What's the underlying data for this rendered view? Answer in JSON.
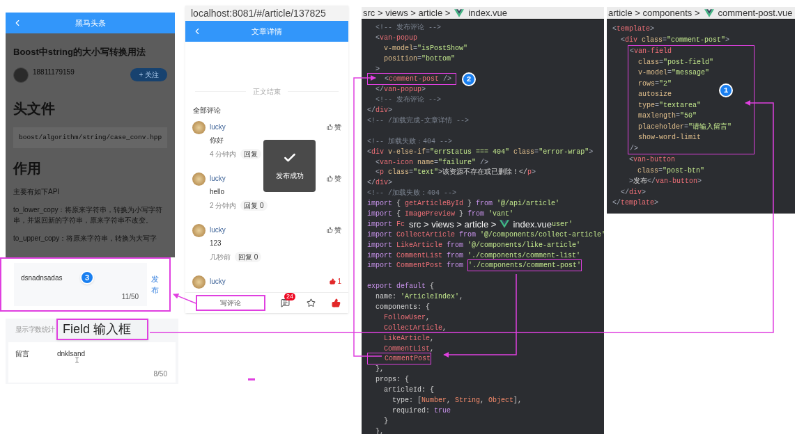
{
  "article_phone": {
    "header": {
      "title": "黑马头条"
    },
    "title": "Boost中string的大小写转换用法",
    "author": {
      "name": "18811179159"
    },
    "follow_button": "+ 关注",
    "heading_1": "头文件",
    "code": "boost/algorithm/string/case_conv.hpp",
    "heading_2": "作用",
    "paragraphs": [
      "主要有如下API",
      "to_lower_copy：将原来字符串，转换为小写字符串，并返回新的字符串，原来字符串不改变。",
      "to_upper_copy：将原来字符串，转换为大写字"
    ],
    "popup": {
      "value": "dsnadnsadas",
      "counter": "11/50",
      "post_button": "发布",
      "badge": "3"
    }
  },
  "field_demo": {
    "section_label": "显示字数统计",
    "label": "留言",
    "value": "dnklsand",
    "counter": "8/50"
  },
  "callout": "Field 输入框",
  "detail_phone": {
    "url": "localhost:8081/#/article/137825",
    "header": {
      "title": "文章详情"
    },
    "end_label": "正文结束",
    "comments_title": "全部评论",
    "comments": [
      {
        "name": "lucky",
        "content": "你好",
        "time": "4 分钟内",
        "reply": "回复",
        "like": "赞",
        "liked": false
      },
      {
        "name": "lucky",
        "content": "hello",
        "time": "2 分钟内",
        "reply": "回复 0",
        "like": "赞",
        "liked": false
      },
      {
        "name": "lucky",
        "content": "123",
        "time": "几秒前",
        "reply": "回复 0",
        "like": "赞",
        "liked": false
      },
      {
        "name": "lucky",
        "like": "1",
        "liked": true
      }
    ],
    "toast": "发布成功",
    "bottom_bar": {
      "write_button": "写评论",
      "comment_count": "24",
      "collected": false,
      "liked": true
    }
  },
  "index_editor": {
    "breadcrumb": {
      "path": "src > views > article >",
      "file": "index.vue"
    },
    "lines": [
      {
        "kind": "code",
        "segments": [
          {
            "kind": "comment",
            "text": "  <!-- 发布评论 -->"
          }
        ]
      },
      {
        "kind": "code",
        "segments": [
          {
            "kind": "punct",
            "text": "  <"
          },
          {
            "kind": "tag",
            "text": "van-popup"
          }
        ]
      },
      {
        "kind": "code",
        "segments": [
          {
            "kind": "attr",
            "text": "    v-model"
          },
          {
            "kind": "punct",
            "text": "="
          },
          {
            "kind": "string",
            "text": "\"isPostShow\""
          }
        ]
      },
      {
        "kind": "code",
        "segments": [
          {
            "kind": "attr",
            "text": "    position"
          },
          {
            "kind": "punct",
            "text": "="
          },
          {
            "kind": "string",
            "text": "\"bottom\""
          }
        ]
      },
      {
        "kind": "code",
        "segments": [
          {
            "kind": "punct",
            "text": "  >"
          }
        ]
      },
      {
        "kind": "code",
        "badge": "2",
        "segments": [
          {
            "kind": "punct",
            "text": "    <",
            "boxed": true
          },
          {
            "kind": "tag",
            "text": "comment-post",
            "boxed": true
          },
          {
            "kind": "punct",
            "text": " /> ",
            "boxed": true
          }
        ]
      },
      {
        "kind": "code",
        "segments": [
          {
            "kind": "punct",
            "text": "  </"
          },
          {
            "kind": "tag",
            "text": "van-popup"
          },
          {
            "kind": "punct",
            "text": ">"
          }
        ]
      },
      {
        "kind": "code",
        "segments": [
          {
            "kind": "comment",
            "text": "  <!-- 发布评论 -->"
          }
        ]
      },
      {
        "kind": "code",
        "segments": [
          {
            "kind": "punct",
            "text": "</"
          },
          {
            "kind": "tag",
            "text": "div"
          },
          {
            "kind": "punct",
            "text": ">"
          }
        ]
      },
      {
        "kind": "code",
        "segments": [
          {
            "kind": "comment",
            "text": "<!-- /加载完成-文章详情 -->"
          }
        ]
      },
      {
        "kind": "blank"
      },
      {
        "kind": "code",
        "segments": [
          {
            "kind": "comment",
            "text": "<!-- 加载失败：404 -->"
          }
        ]
      },
      {
        "kind": "code",
        "segments": [
          {
            "kind": "punct",
            "text": "<"
          },
          {
            "kind": "tag",
            "text": "div"
          },
          {
            "kind": "attr",
            "text": " v-else-if"
          },
          {
            "kind": "punct",
            "text": "="
          },
          {
            "kind": "string",
            "text": "\"errStatus === 404\""
          },
          {
            "kind": "attr",
            "text": " class"
          },
          {
            "kind": "punct",
            "text": "="
          },
          {
            "kind": "string",
            "text": "\"error-wrap\""
          },
          {
            "kind": "punct",
            "text": ">"
          }
        ]
      },
      {
        "kind": "code",
        "segments": [
          {
            "kind": "punct",
            "text": "  <"
          },
          {
            "kind": "tag",
            "text": "van-icon"
          },
          {
            "kind": "attr",
            "text": " name"
          },
          {
            "kind": "punct",
            "text": "="
          },
          {
            "kind": "string",
            "text": "\"failure\""
          },
          {
            "kind": "punct",
            "text": " />"
          }
        ]
      },
      {
        "kind": "code",
        "segments": [
          {
            "kind": "punct",
            "text": "  <"
          },
          {
            "kind": "tag",
            "text": "p"
          },
          {
            "kind": "attr",
            "text": " class"
          },
          {
            "kind": "punct",
            "text": "="
          },
          {
            "kind": "string",
            "text": "\"text\""
          },
          {
            "kind": "plain",
            "text": ">该资源不存在或已删除！</"
          },
          {
            "kind": "tag",
            "text": "p"
          },
          {
            "kind": "punct",
            "text": ">"
          }
        ]
      },
      {
        "kind": "code",
        "segments": [
          {
            "kind": "punct",
            "text": "</"
          },
          {
            "kind": "tag",
            "text": "div"
          },
          {
            "kind": "punct",
            "text": ">"
          }
        ]
      },
      {
        "kind": "code",
        "segments": [
          {
            "kind": "comment",
            "text": "<!-- /加载失败：404 -->"
          }
        ]
      },
      {
        "kind": "code",
        "segments": [
          {
            "kind": "keyword",
            "text": "import"
          },
          {
            "kind": "plain",
            "text": " { "
          },
          {
            "kind": "ident",
            "text": "getArticleById"
          },
          {
            "kind": "plain",
            "text": " } "
          },
          {
            "kind": "keyword",
            "text": "from"
          },
          {
            "kind": "string",
            "text": " '@/api/article'"
          }
        ]
      },
      {
        "kind": "code",
        "segments": [
          {
            "kind": "keyword",
            "text": "import"
          },
          {
            "kind": "plain",
            "text": " { "
          },
          {
            "kind": "ident",
            "text": "ImagePreview"
          },
          {
            "kind": "plain",
            "text": " } "
          },
          {
            "kind": "keyword",
            "text": "from"
          },
          {
            "kind": "string",
            "text": " 'vant'"
          }
        ]
      },
      {
        "kind": "code",
        "segments": [
          {
            "kind": "keyword",
            "text": "import"
          },
          {
            "kind": "ident",
            "text": " Fc "
          },
          {
            "kind": "crumb",
            "text": "src > views > article >"
          },
          {
            "kind": "vue_logo"
          },
          {
            "kind": "crumb",
            "text": "index.vue"
          },
          {
            "kind": "string",
            "text": "user'"
          }
        ]
      },
      {
        "kind": "code",
        "segments": [
          {
            "kind": "keyword",
            "text": "import"
          },
          {
            "kind": "ident",
            "text": " CollectArticle "
          },
          {
            "kind": "keyword",
            "text": "from"
          },
          {
            "kind": "string",
            "text": " '@/components/collect-article'"
          }
        ]
      },
      {
        "kind": "code",
        "segments": [
          {
            "kind": "keyword",
            "text": "import"
          },
          {
            "kind": "ident",
            "text": " LikeArticle "
          },
          {
            "kind": "keyword",
            "text": "from"
          },
          {
            "kind": "string",
            "text": " '@/components/like-article'"
          }
        ]
      },
      {
        "kind": "code",
        "segments": [
          {
            "kind": "keyword",
            "text": "import"
          },
          {
            "kind": "ident",
            "text": " CommentList "
          },
          {
            "kind": "keyword",
            "text": "from"
          },
          {
            "kind": "string",
            "text": " './components/comment-list'"
          }
        ]
      },
      {
        "kind": "code",
        "segments": [
          {
            "kind": "keyword",
            "text": "import"
          },
          {
            "kind": "ident",
            "text": " CommentPost "
          },
          {
            "kind": "keyword",
            "text": "from "
          },
          {
            "kind": "string",
            "text": "'./components/comment-post'",
            "boxed": true
          }
        ]
      },
      {
        "kind": "blank"
      },
      {
        "kind": "code",
        "segments": [
          {
            "kind": "keyword",
            "text": "export default"
          },
          {
            "kind": "plain",
            "text": " {"
          }
        ]
      },
      {
        "kind": "code",
        "segments": [
          {
            "kind": "plain",
            "text": "  name: "
          },
          {
            "kind": "string",
            "text": "'ArticleIndex'"
          },
          {
            "kind": "plain",
            "text": ","
          }
        ]
      },
      {
        "kind": "code",
        "segments": [
          {
            "kind": "plain",
            "text": "  components: {"
          }
        ]
      },
      {
        "kind": "code",
        "segments": [
          {
            "kind": "ident",
            "text": "    FollowUser"
          },
          {
            "kind": "plain",
            "text": ","
          }
        ]
      },
      {
        "kind": "code",
        "segments": [
          {
            "kind": "ident",
            "text": "    CollectArticle"
          },
          {
            "kind": "plain",
            "text": ","
          }
        ]
      },
      {
        "kind": "code",
        "segments": [
          {
            "kind": "ident",
            "text": "    LikeArticle"
          },
          {
            "kind": "plain",
            "text": ","
          }
        ]
      },
      {
        "kind": "code",
        "segments": [
          {
            "kind": "ident",
            "text": "    CommentList"
          },
          {
            "kind": "plain",
            "text": ","
          }
        ]
      },
      {
        "kind": "code",
        "segments": [
          {
            "kind": "ident",
            "text": "    CommentPost",
            "boxed": true
          }
        ]
      },
      {
        "kind": "code",
        "segments": [
          {
            "kind": "plain",
            "text": "  },"
          }
        ]
      },
      {
        "kind": "code",
        "segments": [
          {
            "kind": "plain",
            "text": "  props: {"
          }
        ]
      },
      {
        "kind": "code",
        "segments": [
          {
            "kind": "plain",
            "text": "    articleId: {"
          }
        ]
      },
      {
        "kind": "code",
        "segments": [
          {
            "kind": "plain",
            "text": "      type: ["
          },
          {
            "kind": "number",
            "text": "Number"
          },
          {
            "kind": "plain",
            "text": ", "
          },
          {
            "kind": "number",
            "text": "String"
          },
          {
            "kind": "plain",
            "text": ", "
          },
          {
            "kind": "number",
            "text": "Object"
          },
          {
            "kind": "plain",
            "text": "],"
          }
        ]
      },
      {
        "kind": "code",
        "segments": [
          {
            "kind": "plain",
            "text": "      required: "
          },
          {
            "kind": "keyword",
            "text": "true"
          }
        ]
      },
      {
        "kind": "code",
        "segments": [
          {
            "kind": "plain",
            "text": "    }"
          }
        ]
      },
      {
        "kind": "code",
        "segments": [
          {
            "kind": "plain",
            "text": "  },"
          }
        ]
      }
    ]
  },
  "post_editor": {
    "breadcrumb": {
      "path": "article > components >",
      "file": "comment-post.vue"
    },
    "lines_before": [
      {
        "kind": "code",
        "segments": [
          {
            "kind": "punct",
            "text": "<"
          },
          {
            "kind": "tag",
            "text": "template"
          },
          {
            "kind": "punct",
            "text": ">"
          }
        ]
      },
      {
        "kind": "code",
        "segments": [
          {
            "kind": "punct",
            "text": "  <"
          },
          {
            "kind": "tag",
            "text": "div"
          },
          {
            "kind": "attr",
            "text": " class"
          },
          {
            "kind": "punct",
            "text": "="
          },
          {
            "kind": "string",
            "text": "\"comment-post\""
          },
          {
            "kind": "punct",
            "text": ">"
          }
        ]
      }
    ],
    "highlight": {
      "badge": "1",
      "lines": [
        {
          "kind": "code",
          "segments": [
            {
              "kind": "punct",
              "text": "<"
            },
            {
              "kind": "tag",
              "text": "van-field"
            }
          ]
        },
        {
          "kind": "code",
          "segments": [
            {
              "kind": "attr",
              "text": "  class"
            },
            {
              "kind": "punct",
              "text": "="
            },
            {
              "kind": "string",
              "text": "\"post-field\""
            }
          ]
        },
        {
          "kind": "code",
          "segments": [
            {
              "kind": "attr",
              "text": "  v-model"
            },
            {
              "kind": "punct",
              "text": "="
            },
            {
              "kind": "string",
              "text": "\"message\""
            }
          ]
        },
        {
          "kind": "code",
          "segments": [
            {
              "kind": "attr",
              "text": "  rows"
            },
            {
              "kind": "punct",
              "text": "="
            },
            {
              "kind": "string",
              "text": "\"2\""
            }
          ]
        },
        {
          "kind": "code",
          "segments": [
            {
              "kind": "attr",
              "text": "  autosize"
            }
          ]
        },
        {
          "kind": "code",
          "segments": [
            {
              "kind": "attr",
              "text": "  type"
            },
            {
              "kind": "punct",
              "text": "="
            },
            {
              "kind": "string",
              "text": "\"textarea\""
            }
          ]
        },
        {
          "kind": "code",
          "segments": [
            {
              "kind": "attr",
              "text": "  maxlength"
            },
            {
              "kind": "punct",
              "text": "="
            },
            {
              "kind": "string",
              "text": "\"50\""
            }
          ]
        },
        {
          "kind": "code",
          "segments": [
            {
              "kind": "attr",
              "text": "  placeholder"
            },
            {
              "kind": "punct",
              "text": "="
            },
            {
              "kind": "string",
              "text": "\"请输入留言\""
            }
          ]
        },
        {
          "kind": "code",
          "segments": [
            {
              "kind": "attr",
              "text": "  show-word-limit"
            }
          ]
        },
        {
          "kind": "code",
          "segments": [
            {
              "kind": "punct",
              "text": "/>"
            }
          ]
        }
      ]
    },
    "lines_after": [
      {
        "kind": "code",
        "segments": [
          {
            "kind": "punct",
            "text": "    <"
          },
          {
            "kind": "tag",
            "text": "van-button"
          }
        ]
      },
      {
        "kind": "code",
        "segments": [
          {
            "kind": "attr",
            "text": "      class"
          },
          {
            "kind": "punct",
            "text": "="
          },
          {
            "kind": "string",
            "text": "\"post-btn\""
          }
        ]
      },
      {
        "kind": "code",
        "segments": [
          {
            "kind": "punct",
            "text": "    >"
          },
          {
            "kind": "plain",
            "text": "发布"
          },
          {
            "kind": "punct",
            "text": "</"
          },
          {
            "kind": "tag",
            "text": "van-button"
          },
          {
            "kind": "punct",
            "text": ">"
          }
        ]
      },
      {
        "kind": "code",
        "segments": [
          {
            "kind": "punct",
            "text": "  </"
          },
          {
            "kind": "tag",
            "text": "div"
          },
          {
            "kind": "punct",
            "text": ">"
          }
        ]
      },
      {
        "kind": "code",
        "segments": [
          {
            "kind": "punct",
            "text": "</"
          },
          {
            "kind": "tag",
            "text": "template"
          },
          {
            "kind": "punct",
            "text": ">"
          }
        ]
      }
    ]
  }
}
